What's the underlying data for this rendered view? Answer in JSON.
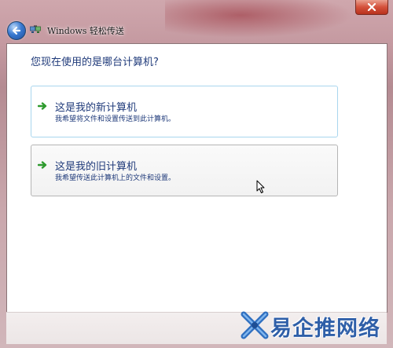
{
  "window": {
    "title": "Windows 轻松传送"
  },
  "main": {
    "question": "您现在使用的是哪台计算机?"
  },
  "options": [
    {
      "title": "这是我的新计算机",
      "description": "我希望将文件和设置传送到此计算机。"
    },
    {
      "title": "这是我的旧计算机",
      "description": "我希望传送此计算机上的文件和设置。"
    }
  ],
  "watermark": {
    "text": "易企推网络"
  },
  "colors": {
    "link_text": "#1f3a7a",
    "arrow_green": "#2e9a2e",
    "selected_border": "#a9d6ee"
  },
  "icons": {
    "back": "back-arrow-icon",
    "close": "close-icon",
    "app": "easy-transfer-icon",
    "option_arrow": "green-arrow-icon"
  }
}
